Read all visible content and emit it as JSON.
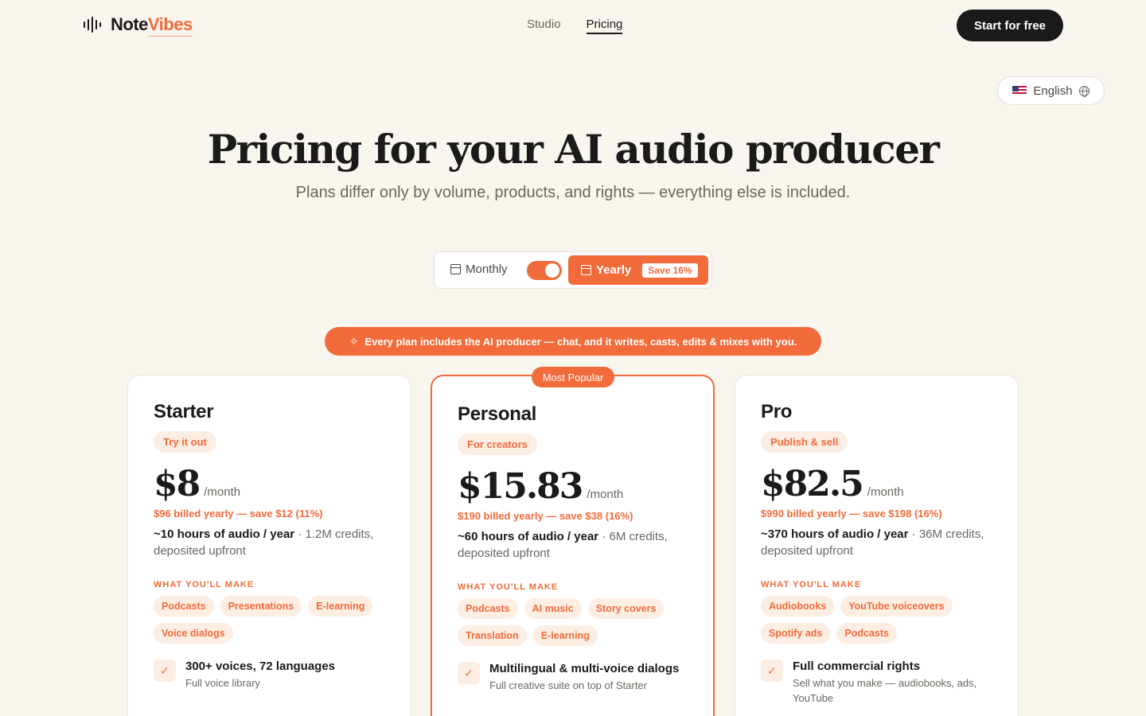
{
  "brand": {
    "note": "Note",
    "vibes": "Vibes"
  },
  "nav": {
    "studio": "Studio",
    "pricing": "Pricing"
  },
  "cta": "Start for free",
  "language": "English",
  "hero": {
    "title": "Pricing for your AI audio producer",
    "subtitle": "Plans differ only by volume, products, and rights — everything else is included."
  },
  "billing": {
    "monthly": "Monthly",
    "yearly": "Yearly",
    "save": "Save 16%",
    "yearly_selected": true
  },
  "banner": "Every plan includes the AI producer — chat, and it writes, casts, edits & mixes with you.",
  "popular_badge": "Most Popular",
  "plans": [
    {
      "name": "Starter",
      "tag": "Try it out",
      "price": "$8",
      "per": "/month",
      "billed": "$96 billed yearly — save $12 (11%)",
      "hours": "~10 hours of audio / year",
      "credits": " · 1.2M credits, deposited upfront",
      "make_label": "WHAT YOU'LL MAKE",
      "chips": [
        "Podcasts",
        "Presentations",
        "E-learning",
        "Voice dialogs"
      ],
      "feature": {
        "title": "300+ voices, 72 languages",
        "sub": "Full voice library"
      }
    },
    {
      "name": "Personal",
      "tag": "For creators",
      "price": "$15.83",
      "per": "/month",
      "billed": "$190 billed yearly — save $38 (16%)",
      "hours": "~60 hours of audio / year",
      "credits": " · 6M credits, deposited upfront",
      "make_label": "WHAT YOU'LL MAKE",
      "chips": [
        "Podcasts",
        "AI music",
        "Story covers",
        "Translation",
        "E-learning"
      ],
      "feature": {
        "title": "Multilingual & multi-voice dialogs",
        "sub": "Full creative suite on top of Starter"
      }
    },
    {
      "name": "Pro",
      "tag": "Publish & sell",
      "price": "$82.5",
      "per": "/month",
      "billed": "$990 billed yearly — save $198 (16%)",
      "hours": "~370 hours of audio / year",
      "credits": " · 36M credits, deposited upfront",
      "make_label": "WHAT YOU'LL MAKE",
      "chips": [
        "Audiobooks",
        "YouTube voiceovers",
        "Spotify ads",
        "Podcasts"
      ],
      "feature": {
        "title": "Full commercial rights",
        "sub": "Sell what you make — audiobooks, ads, YouTube"
      }
    }
  ],
  "colors": {
    "accent": "#f26b3a",
    "background": "#f9f5ef",
    "dark": "#1a1a1a"
  },
  "icons": {
    "logo": "waveform-icon",
    "language": "globe-icon",
    "calendar": "calendar-icon",
    "sparkle": "sparkle-icon",
    "check": "check-icon"
  }
}
